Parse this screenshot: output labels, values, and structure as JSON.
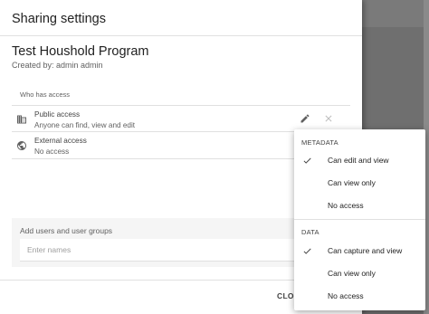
{
  "dialog": {
    "title": "Sharing settings",
    "program_name": "Test Houshold Program",
    "created_by": "Created by: admin admin",
    "who_has_access": "Who has access",
    "close_label": "CLO"
  },
  "access": [
    {
      "title": "Public access",
      "subtitle": "Anyone can find, view and edit",
      "icon": "building-icon"
    },
    {
      "title": "External access",
      "subtitle": "No access",
      "icon": "globe-icon"
    }
  ],
  "add_users": {
    "label": "Add users and user groups",
    "placeholder": "Enter names"
  },
  "menu": {
    "metadata_label": "METADATA",
    "metadata_options": [
      {
        "label": "Can edit and view",
        "checked": true
      },
      {
        "label": "Can view only",
        "checked": false
      },
      {
        "label": "No access",
        "checked": false
      }
    ],
    "data_label": "DATA",
    "data_options": [
      {
        "label": "Can capture and view",
        "checked": true
      },
      {
        "label": "Can view only",
        "checked": false
      },
      {
        "label": "No access",
        "checked": false
      }
    ]
  },
  "colors": {
    "overlay": "#757575",
    "icon": "#616161",
    "divider": "#e0e0e0"
  }
}
